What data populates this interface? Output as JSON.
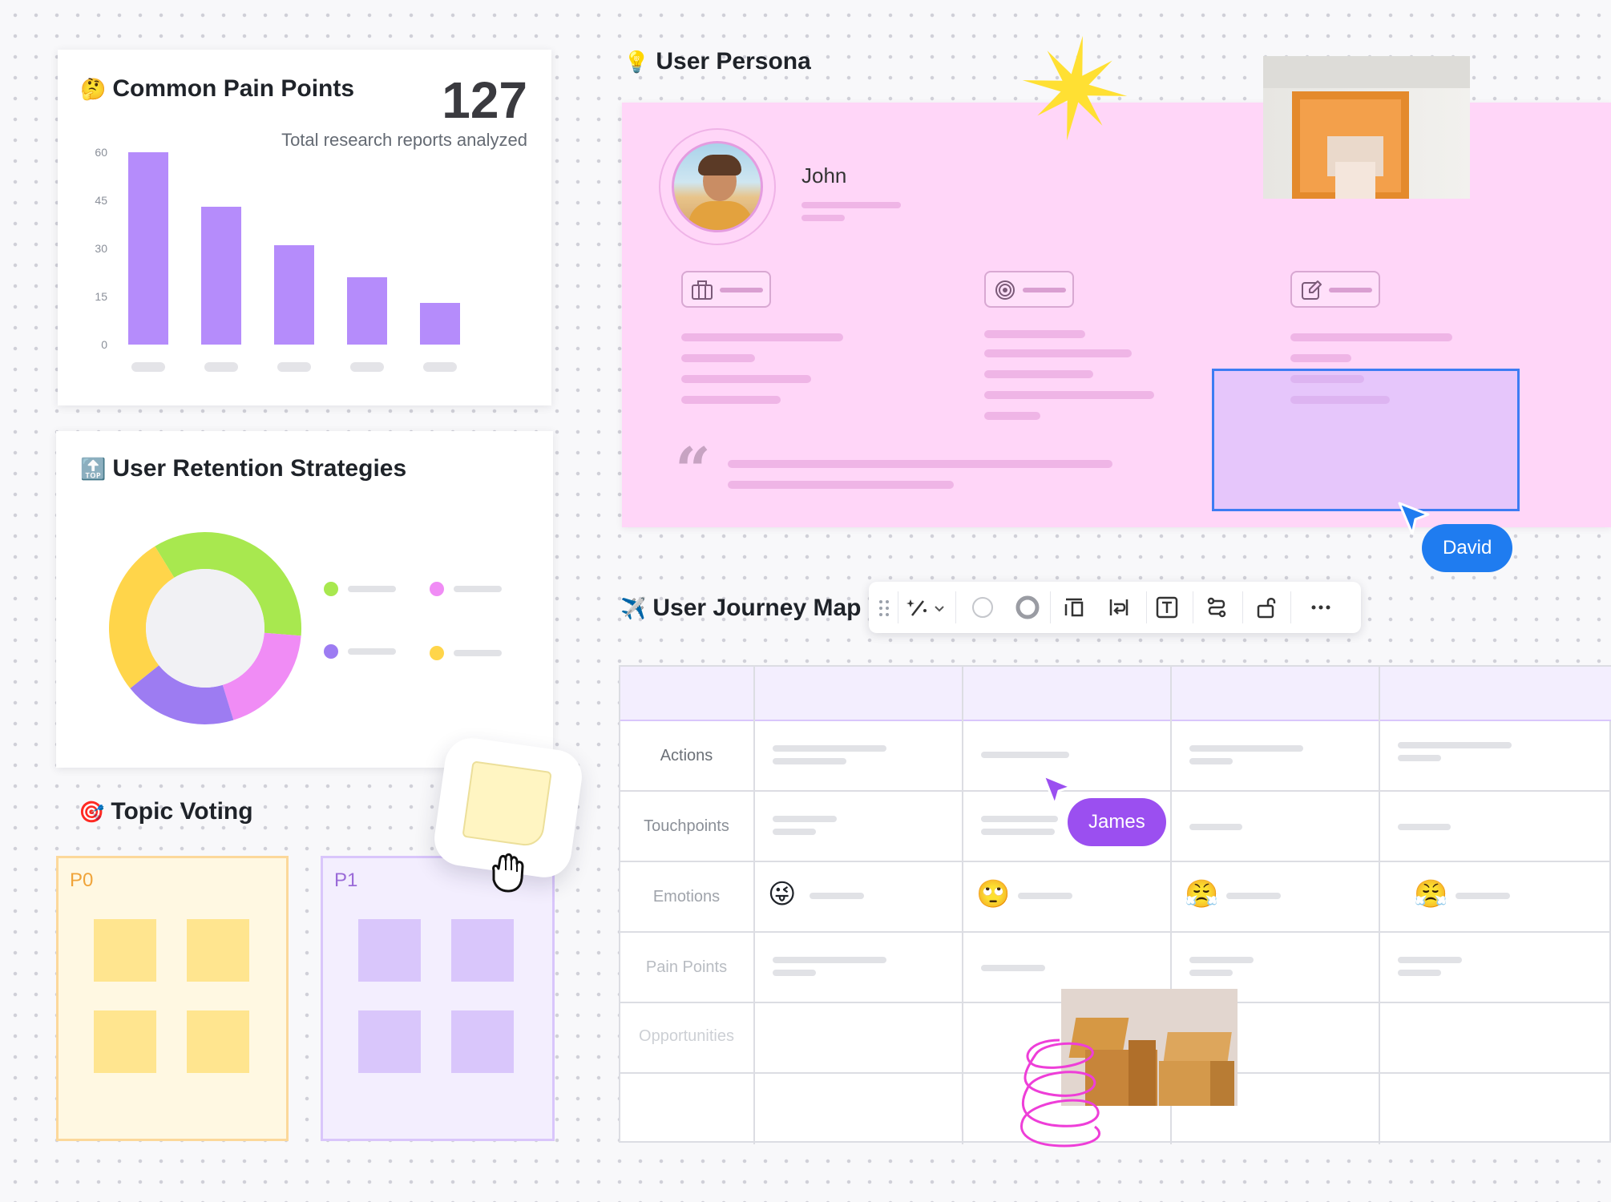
{
  "pain_points": {
    "title": "Common Pain Points",
    "emoji": "🤔",
    "metric_value": "127",
    "metric_caption": "Total research reports analyzed"
  },
  "chart_data": {
    "type": "bar",
    "categories": [
      "",
      "",
      "",
      "",
      ""
    ],
    "values": [
      60,
      43,
      31,
      21,
      13
    ],
    "ylim": [
      0,
      60
    ],
    "yticks": [
      "60",
      "45",
      "30",
      "15",
      "0"
    ],
    "bar_color": "#b58cfb",
    "grid": false
  },
  "retention": {
    "title": "User Retention Strategies",
    "emoji": "🔝",
    "donut": [
      {
        "color": "#a8e84f",
        "value": 35
      },
      {
        "color": "#f08cf5",
        "value": 19
      },
      {
        "color": "#9d7cf2",
        "value": 19
      },
      {
        "color": "#ffd54a",
        "value": 27
      }
    ]
  },
  "voting": {
    "title": "Topic Voting",
    "emoji": "🎯",
    "columns": [
      {
        "label": "P0",
        "color": "#f0a43a"
      },
      {
        "label": "P1",
        "color": "#9a6ad8"
      }
    ]
  },
  "persona": {
    "title": "User Persona",
    "emoji": "💡",
    "name": "John",
    "background": "#ffd6f8",
    "icons": [
      "briefcase-icon",
      "target-icon",
      "edit-icon"
    ]
  },
  "journey": {
    "title": "User Journey Map",
    "emoji": "✈️",
    "rows": [
      "Actions",
      "Touchpoints",
      "Emotions",
      "Pain Points",
      "Opportunities"
    ],
    "emotions": [
      "😜",
      "🙄",
      "😤",
      "😤"
    ]
  },
  "collaborators": {
    "david": {
      "name": "David",
      "color": "#1f7cf0"
    },
    "james": {
      "name": "James",
      "color": "#9b4ff0"
    }
  },
  "toolbar": {
    "icons": [
      "drag-handle-icon",
      "magic-wand-icon",
      "circle-outline-icon",
      "circle-filled-icon",
      "align-icon",
      "wrap-icon",
      "text-icon",
      "connector-icon",
      "unlock-icon",
      "more-icon"
    ]
  }
}
